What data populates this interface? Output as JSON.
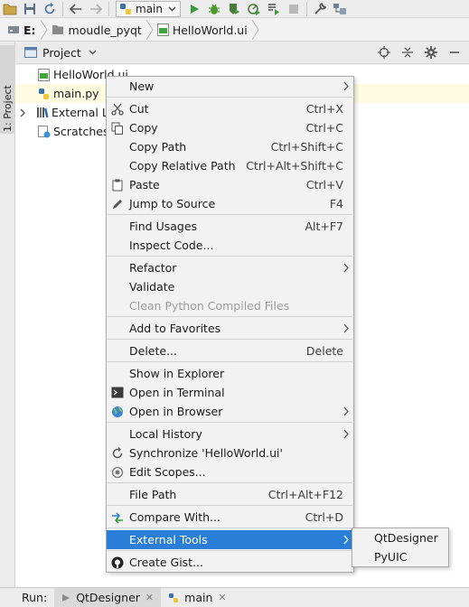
{
  "toolbar": {
    "run_config_label": "main",
    "colors": {
      "run": "#3a9a3a",
      "bug": "#4a9a2a",
      "gray": "#8a8a8a"
    }
  },
  "breadcrumb": {
    "items": [
      "E:",
      "moudle_pyqt",
      "HelloWorld.ui"
    ]
  },
  "left_stripe": {
    "tab_label": "1: Project"
  },
  "project_panel": {
    "title": "Project",
    "tree": [
      {
        "label": "HelloWorld.ui",
        "icon": "qt-file-icon"
      },
      {
        "label": "main.py",
        "icon": "python-file-icon"
      },
      {
        "label": "External Li",
        "icon": "library-icon"
      },
      {
        "label": "Scratches a",
        "icon": "scratches-icon"
      }
    ]
  },
  "context_menu": {
    "items": [
      {
        "label": "New",
        "shortcut": "",
        "submenu": true
      },
      {
        "label": "Cut",
        "shortcut": "Ctrl+X",
        "icon": "scissors-icon"
      },
      {
        "label": "Copy",
        "shortcut": "Ctrl+C",
        "icon": "copy-icon"
      },
      {
        "label": "Copy Path",
        "shortcut": "Ctrl+Shift+C"
      },
      {
        "label": "Copy Relative Path",
        "shortcut": "Ctrl+Alt+Shift+C"
      },
      {
        "label": "Paste",
        "shortcut": "Ctrl+V",
        "icon": "paste-icon"
      },
      {
        "label": "Jump to Source",
        "shortcut": "F4",
        "icon": "pencil-icon"
      },
      {
        "label": "Find Usages",
        "shortcut": "Alt+F7"
      },
      {
        "label": "Inspect Code...",
        "shortcut": ""
      },
      {
        "label": "Refactor",
        "shortcut": "",
        "submenu": true
      },
      {
        "label": "Validate",
        "shortcut": ""
      },
      {
        "label": "Clean Python Compiled Files",
        "shortcut": "",
        "disabled": true
      },
      {
        "label": "Add to Favorites",
        "shortcut": "",
        "submenu": true
      },
      {
        "label": "Delete...",
        "shortcut": "Delete"
      },
      {
        "label": "Show in Explorer",
        "shortcut": ""
      },
      {
        "label": "Open in Terminal",
        "shortcut": "",
        "icon": "terminal-icon"
      },
      {
        "label": "Open in Browser",
        "shortcut": "",
        "submenu": true,
        "icon": "globe-icon"
      },
      {
        "label": "Local History",
        "shortcut": "",
        "submenu": true
      },
      {
        "label": "Synchronize 'HelloWorld.ui'",
        "shortcut": "",
        "icon": "sync-icon"
      },
      {
        "label": "Edit Scopes...",
        "shortcut": "",
        "icon": "scope-icon"
      },
      {
        "label": "File Path",
        "shortcut": "Ctrl+Alt+F12"
      },
      {
        "label": "Compare With...",
        "shortcut": "Ctrl+D",
        "icon": "compare-icon"
      },
      {
        "label": "External Tools",
        "shortcut": "",
        "submenu": true,
        "active": true
      },
      {
        "label": "Create Gist...",
        "shortcut": "",
        "icon": "github-icon"
      }
    ],
    "active_color": "#2a7ed8"
  },
  "submenu": {
    "items": [
      "QtDesigner",
      "PyUIC"
    ]
  },
  "runbar": {
    "label": "Run:",
    "tabs": [
      "QtDesigner",
      "main"
    ]
  }
}
